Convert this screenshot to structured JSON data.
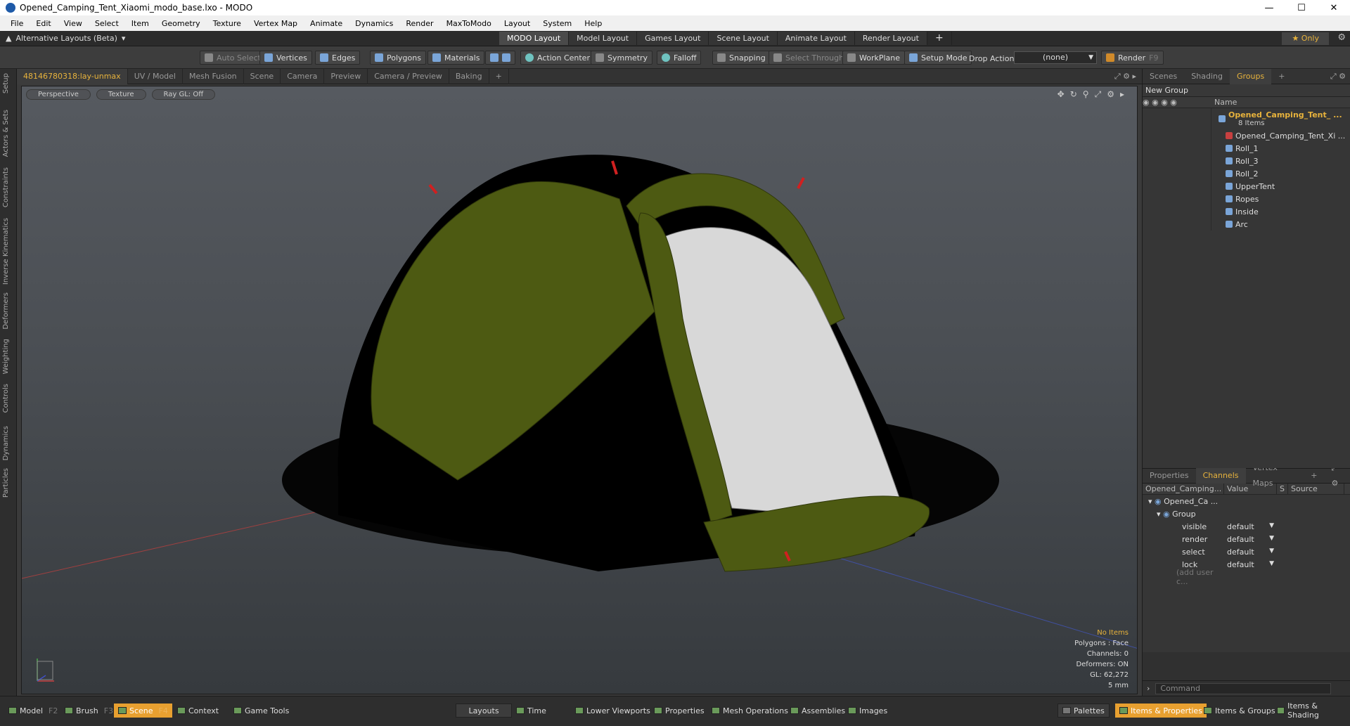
{
  "window": {
    "title": "Opened_Camping_Tent_Xiaomi_modo_base.lxo - MODO"
  },
  "menu": [
    "File",
    "Edit",
    "View",
    "Select",
    "Item",
    "Geometry",
    "Texture",
    "Vertex Map",
    "Animate",
    "Dynamics",
    "Render",
    "MaxToModo",
    "Layout",
    "System",
    "Help"
  ],
  "layoutbar": {
    "alt_layout": "Alternative Layouts (Beta)",
    "tabs": [
      "MODO Layout",
      "Model Layout",
      "Games Layout",
      "Scene Layout",
      "Animate Layout",
      "Render Layout"
    ],
    "only": "Only"
  },
  "toolbar": {
    "auto_select": "Auto Select",
    "vertices": "Vertices",
    "edges": "Edges",
    "polygons": "Polygons",
    "materials": "Materials",
    "action_center": "Action Center",
    "symmetry": "Symmetry",
    "falloff": "Falloff",
    "snapping": "Snapping",
    "select_through": "Select Through",
    "workplane": "WorkPlane",
    "setup_mode": "Setup Mode",
    "drop_action": "Drop Action",
    "drop_value": "(none)",
    "render": "Render",
    "render_key": "F9"
  },
  "leftstrip": [
    "Setup",
    "Actors & Sets",
    "Constraints",
    "Inverse Kinematics",
    "Deformers",
    "Weighting",
    "Controls",
    "Dynamics",
    "Particles"
  ],
  "viewport_tabs": [
    "48146780318:lay-unmax",
    "UV / Model",
    "Mesh Fusion",
    "Scene",
    "Camera",
    "Preview",
    "Camera / Preview",
    "Baking"
  ],
  "viewport": {
    "view": "Perspective",
    "shading": "Texture",
    "raygl": "Ray GL: Off",
    "info": {
      "items": "No Items",
      "polygons": "Polygons : Face",
      "channels": "Channels: 0",
      "deformers": "Deformers: ON",
      "gl": "GL: 62,272",
      "scale": "5 mm"
    }
  },
  "right_top_tabs": [
    "Scenes",
    "Shading",
    "Groups"
  ],
  "groups": {
    "new_group": "New Group",
    "name_header": "Name",
    "root": "Opened_Camping_Tent_ ...",
    "root_count": "8 Items",
    "children": [
      "Opened_Camping_Tent_Xi ...",
      "Roll_1",
      "Roll_3",
      "Roll_2",
      "UpperTent",
      "Ropes",
      "Inside",
      "Arc"
    ]
  },
  "right_bottom_tabs": [
    "Properties",
    "Channels",
    "Vertex Maps"
  ],
  "channels": {
    "headers": [
      "Opened_Camping...",
      "Value",
      "S",
      "Source"
    ],
    "root": "Opened_Ca ...",
    "group": "Group",
    "rows": [
      {
        "name": "visible",
        "value": "default"
      },
      {
        "name": "render",
        "value": "default"
      },
      {
        "name": "select",
        "value": "default"
      },
      {
        "name": "lock",
        "value": "default"
      }
    ],
    "add_user": "(add user c..."
  },
  "command_placeholder": "Command",
  "bottombar": {
    "model": "Model",
    "model_key": "F2",
    "brush": "Brush",
    "brush_key": "F3",
    "scene": "Scene",
    "scene_key": "F4",
    "context": "Context",
    "game_tools": "Game Tools",
    "layouts": "Layouts",
    "time": "Time",
    "lower_viewports": "Lower Viewports",
    "properties": "Properties",
    "mesh_operations": "Mesh Operations",
    "assemblies": "Assemblies",
    "images": "Images",
    "palettes": "Palettes",
    "items_properties": "Items & Properties",
    "items_groups": "Items & Groups",
    "items_shading": "Items & Shading"
  },
  "colors": {
    "accent": "#e8b33c",
    "tent_green": "#4d5a12",
    "background": "#3a3a3a"
  }
}
